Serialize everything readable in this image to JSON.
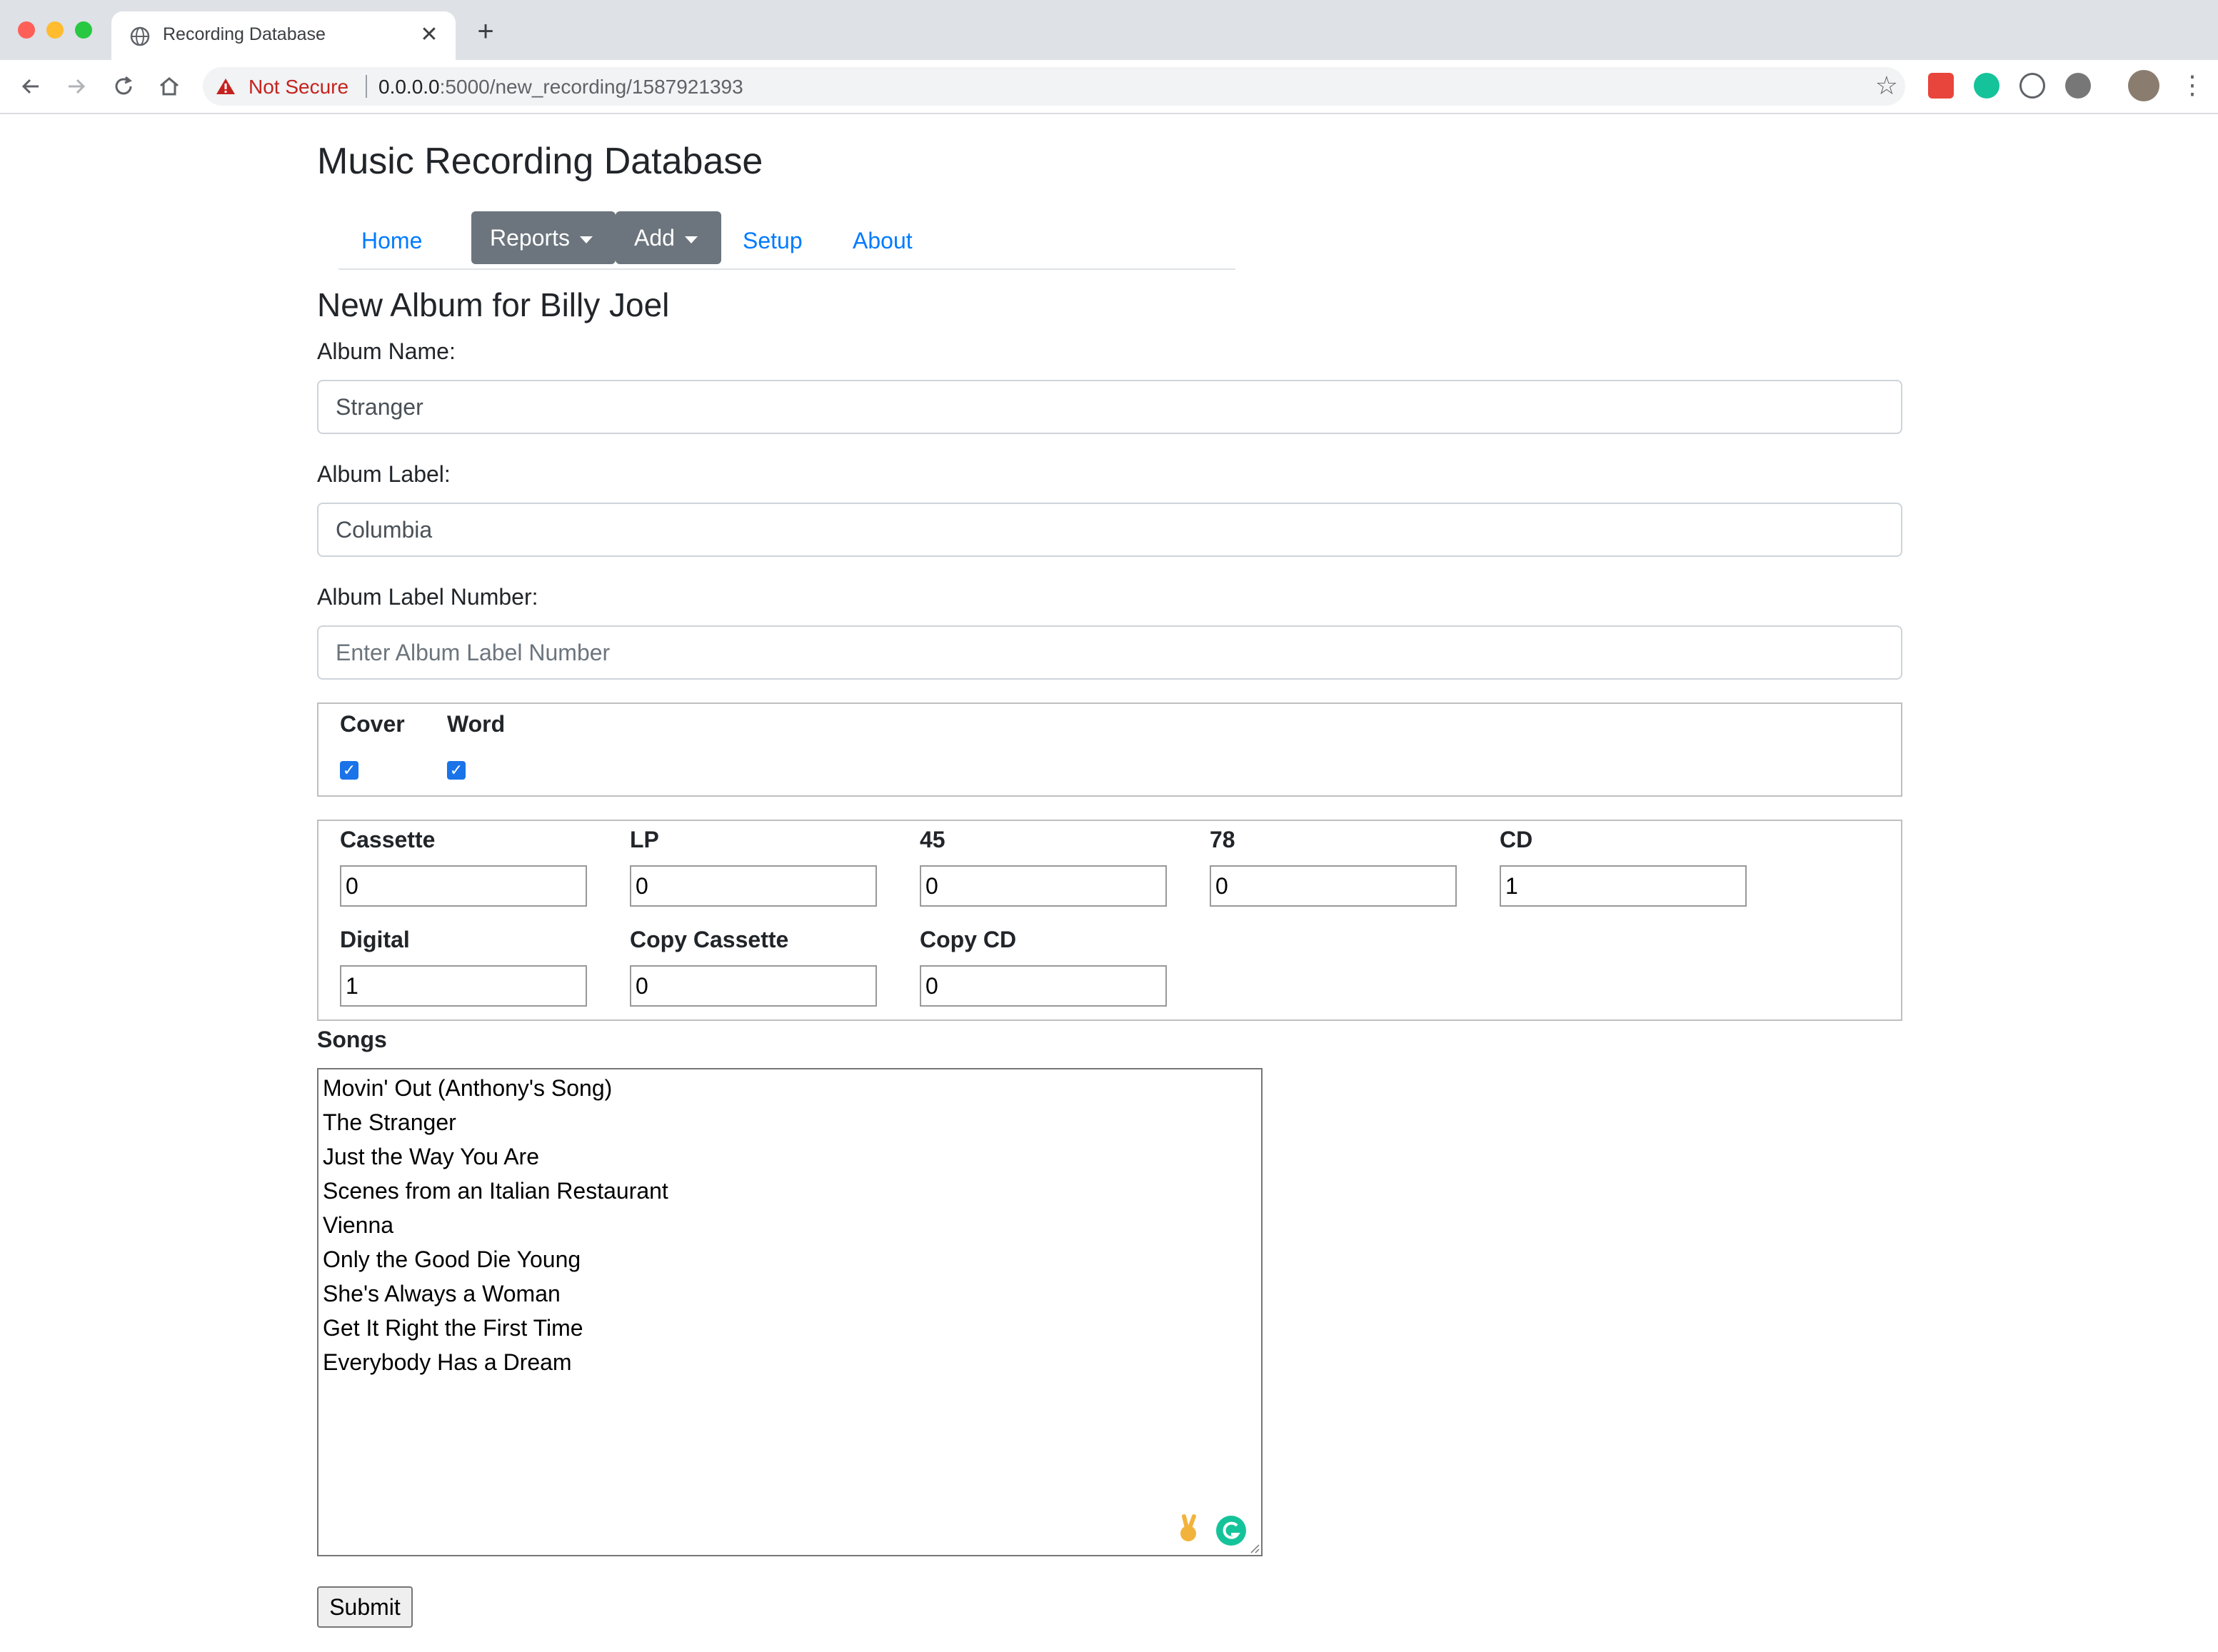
{
  "browser": {
    "tab_title": "Recording Database",
    "new_tab_symbol": "+",
    "security_label": "Not Secure",
    "url_host": "0.0.0.0",
    "url_path": ":5000/new_recording/1587921393"
  },
  "site": {
    "title": "Music Recording Database",
    "nav": {
      "home": "Home",
      "reports": "Reports",
      "add": "Add",
      "setup": "Setup",
      "about": "About"
    }
  },
  "form": {
    "heading": "New Album for Billy Joel",
    "album_name_label": "Album Name:",
    "album_name_value": "Stranger",
    "album_label_label": "Album Label:",
    "album_label_value": "Columbia",
    "album_label_number_label": "Album Label Number:",
    "album_label_number_placeholder": "Enter Album Label Number",
    "checkboxes": [
      {
        "label": "Cover",
        "checked": true
      },
      {
        "label": "Word",
        "checked": true
      }
    ],
    "formats": [
      {
        "label": "Cassette",
        "value": "0"
      },
      {
        "label": "LP",
        "value": "0"
      },
      {
        "label": "45",
        "value": "0"
      },
      {
        "label": "78",
        "value": "0"
      },
      {
        "label": "CD",
        "value": "1"
      },
      {
        "label": "Digital",
        "value": "1"
      },
      {
        "label": "Copy Cassette",
        "value": "0"
      },
      {
        "label": "Copy CD",
        "value": "0"
      }
    ],
    "songs_label": "Songs",
    "songs": [
      "Movin' Out (Anthony's Song)",
      "The Stranger",
      "Just the Way You Are",
      "Scenes from an Italian Restaurant",
      "Vienna",
      "Only the Good Die Young",
      "She's Always a Woman",
      "Get It Right the First Time",
      "Everybody Has a Dream"
    ],
    "submit_label": "Submit"
  }
}
